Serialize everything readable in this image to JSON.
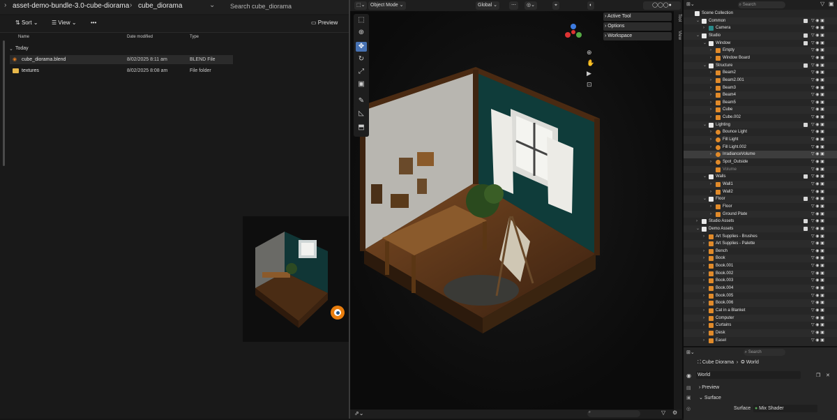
{
  "explorer": {
    "breadcrumb": [
      "asset-demo-bundle-3.0-cube-diorama",
      "cube_diorama"
    ],
    "search_placeholder": "Search cube_diorama",
    "toolbar": {
      "sort": "Sort",
      "view": "View",
      "more": "•••",
      "preview": "Preview"
    },
    "columns": {
      "name": "Name",
      "date": "Date modified",
      "type": "Type"
    },
    "group": "Today",
    "files": [
      {
        "name": "cube_diorama.blend",
        "date": "8/02/2025 8:11 am",
        "type": "BLEND File"
      },
      {
        "name": "textures",
        "date": "8/02/2025 8:08 am",
        "type": "File folder"
      }
    ]
  },
  "viewport": {
    "mode": "Object Mode",
    "orientation": "Global",
    "panels": [
      "Active Tool",
      "Options",
      "Workspace"
    ],
    "side_tabs": [
      "Tool",
      "View"
    ]
  },
  "outliner": {
    "search_placeholder": "Search",
    "rows": [
      {
        "label": "Scene Collection",
        "indent": 0,
        "arrow": "",
        "icon": "collection"
      },
      {
        "label": "Common",
        "indent": 1,
        "arrow": "v",
        "icon": "collection"
      },
      {
        "label": "Camera",
        "indent": 2,
        "arrow": ">",
        "icon": "camera"
      },
      {
        "label": "Studio",
        "indent": 1,
        "arrow": "v",
        "icon": "collection"
      },
      {
        "label": "Window",
        "indent": 2,
        "arrow": "v",
        "icon": "collection"
      },
      {
        "label": "Empty",
        "indent": 3,
        "arrow": ">",
        "icon": "empty"
      },
      {
        "label": "Window Board",
        "indent": 3,
        "arrow": ">",
        "icon": "mesh"
      },
      {
        "label": "Structure",
        "indent": 2,
        "arrow": "v",
        "icon": "collection"
      },
      {
        "label": "Beam2",
        "indent": 3,
        "arrow": ">",
        "icon": "mesh"
      },
      {
        "label": "Beam2.001",
        "indent": 3,
        "arrow": ">",
        "icon": "mesh"
      },
      {
        "label": "Beam3",
        "indent": 3,
        "arrow": ">",
        "icon": "mesh"
      },
      {
        "label": "Beam4",
        "indent": 3,
        "arrow": ">",
        "icon": "mesh"
      },
      {
        "label": "Beam5",
        "indent": 3,
        "arrow": ">",
        "icon": "mesh"
      },
      {
        "label": "Cube",
        "indent": 3,
        "arrow": ">",
        "icon": "mesh"
      },
      {
        "label": "Cube.002",
        "indent": 3,
        "arrow": ">",
        "icon": "mesh"
      },
      {
        "label": "Lighting",
        "indent": 2,
        "arrow": "v",
        "icon": "collection"
      },
      {
        "label": "Bounce Light",
        "indent": 3,
        "arrow": ">",
        "icon": "light"
      },
      {
        "label": "Fill Light",
        "indent": 3,
        "arrow": ">",
        "icon": "light"
      },
      {
        "label": "Fill Light.002",
        "indent": 3,
        "arrow": ">",
        "icon": "light"
      },
      {
        "label": "IrradianceVolume",
        "indent": 3,
        "arrow": ">",
        "icon": "light"
      },
      {
        "label": "Spot_Outside",
        "indent": 3,
        "arrow": ">",
        "icon": "light"
      },
      {
        "label": "Volume",
        "indent": 3,
        "arrow": "",
        "icon": "mesh"
      },
      {
        "label": "Walls",
        "indent": 2,
        "arrow": "v",
        "icon": "collection"
      },
      {
        "label": "Wall1",
        "indent": 3,
        "arrow": ">",
        "icon": "mesh"
      },
      {
        "label": "Wall2",
        "indent": 3,
        "arrow": ">",
        "icon": "mesh"
      },
      {
        "label": "Floor",
        "indent": 2,
        "arrow": "v",
        "icon": "collection"
      },
      {
        "label": "Floor",
        "indent": 3,
        "arrow": ">",
        "icon": "mesh"
      },
      {
        "label": "Ground Plate",
        "indent": 3,
        "arrow": ">",
        "icon": "mesh"
      },
      {
        "label": "Studio Assets",
        "indent": 1,
        "arrow": ">",
        "icon": "collection"
      },
      {
        "label": "Demo Assets",
        "indent": 1,
        "arrow": "v",
        "icon": "collection"
      },
      {
        "label": "Art Supplies - Brushes",
        "indent": 2,
        "arrow": ">",
        "icon": "mesh"
      },
      {
        "label": "Art Supplies - Palette",
        "indent": 2,
        "arrow": ">",
        "icon": "mesh"
      },
      {
        "label": "Bench",
        "indent": 2,
        "arrow": ">",
        "icon": "mesh"
      },
      {
        "label": "Book",
        "indent": 2,
        "arrow": ">",
        "icon": "mesh"
      },
      {
        "label": "Book.001",
        "indent": 2,
        "arrow": ">",
        "icon": "mesh"
      },
      {
        "label": "Book.002",
        "indent": 2,
        "arrow": ">",
        "icon": "mesh"
      },
      {
        "label": "Book.003",
        "indent": 2,
        "arrow": ">",
        "icon": "mesh"
      },
      {
        "label": "Book.004",
        "indent": 2,
        "arrow": ">",
        "icon": "mesh"
      },
      {
        "label": "Book.005",
        "indent": 2,
        "arrow": ">",
        "icon": "mesh"
      },
      {
        "label": "Book.006",
        "indent": 2,
        "arrow": ">",
        "icon": "mesh"
      },
      {
        "label": "Cat in a Blanket",
        "indent": 2,
        "arrow": ">",
        "icon": "mesh"
      },
      {
        "label": "Computer",
        "indent": 2,
        "arrow": ">",
        "icon": "mesh"
      },
      {
        "label": "Curtains",
        "indent": 2,
        "arrow": ">",
        "icon": "mesh"
      },
      {
        "label": "Desk",
        "indent": 2,
        "arrow": ">",
        "icon": "mesh"
      },
      {
        "label": "Easel",
        "indent": 2,
        "arrow": ">",
        "icon": "mesh"
      }
    ]
  },
  "properties": {
    "search_placeholder": "Search",
    "scene": "Cube Diorama",
    "world": "World",
    "world_field": "World",
    "preview": "Preview",
    "surface_section": "Surface",
    "surface_label": "Surface",
    "surface_value": "Mix Shader"
  },
  "colors": {
    "teal_wall": "#123b3b",
    "wood": "#6b3e1c",
    "outliner_bg": "#262626",
    "accent": "#4772b3"
  }
}
